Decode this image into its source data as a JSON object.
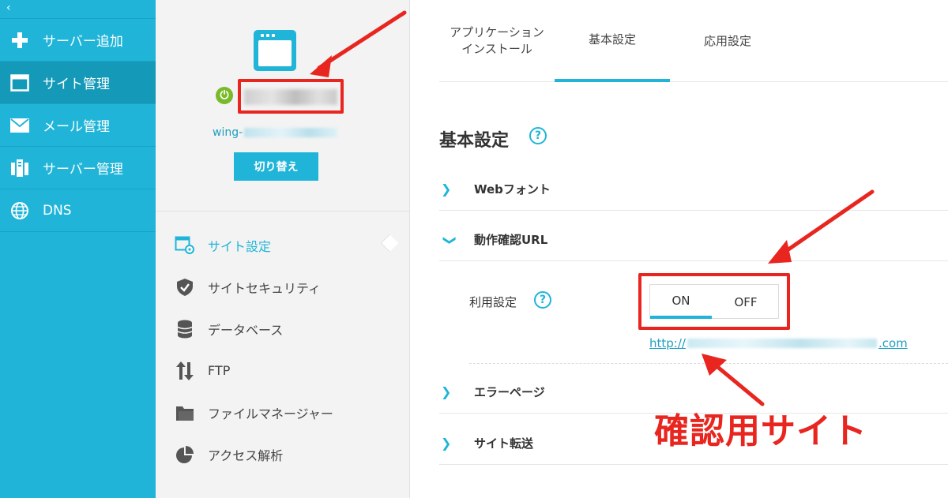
{
  "nav": {
    "collapse_glyph": "‹",
    "items": [
      {
        "label": "サーバー追加",
        "icon": "plus-icon"
      },
      {
        "label": "サイト管理",
        "icon": "window-icon",
        "active": true
      },
      {
        "label": "メール管理",
        "icon": "mail-icon"
      },
      {
        "label": "サーバー管理",
        "icon": "server-icon"
      },
      {
        "label": "DNS",
        "icon": "globe-icon"
      }
    ]
  },
  "site": {
    "domain_prefix": "wing-",
    "switch_label": "切り替え"
  },
  "menu": {
    "items": [
      {
        "label": "サイト設定",
        "icon": "site-settings-icon",
        "active": true
      },
      {
        "label": "サイトセキュリティ",
        "icon": "shield-icon"
      },
      {
        "label": "データベース",
        "icon": "database-icon"
      },
      {
        "label": "FTP",
        "icon": "ftp-arrows-icon"
      },
      {
        "label": "ファイルマネージャー",
        "icon": "folder-icon"
      },
      {
        "label": "アクセス解析",
        "icon": "pie-chart-icon"
      }
    ]
  },
  "tabs": [
    {
      "label": "アプリケーション\nインストール"
    },
    {
      "label": "基本設定",
      "active": true
    },
    {
      "label": "応用設定"
    }
  ],
  "settings": {
    "title": "基本設定",
    "help_glyph": "?",
    "sections": [
      {
        "label": "Webフォント",
        "expanded": false
      },
      {
        "label": "動作確認URL",
        "expanded": true
      },
      {
        "label": "エラーページ",
        "expanded": false
      },
      {
        "label": "サイト転送",
        "expanded": false
      }
    ],
    "usage_label": "利用設定",
    "toggle": {
      "on": "ON",
      "off": "OFF",
      "selected": "ON"
    },
    "url_prefix": "http://",
    "url_suffix": ".com"
  },
  "annotation": {
    "text": "確認用サイト",
    "color": "#e8261f"
  },
  "colors": {
    "accent": "#20b5d8",
    "nav_active": "#1499b8",
    "power": "#7ab929",
    "highlight": "#e8261f"
  }
}
